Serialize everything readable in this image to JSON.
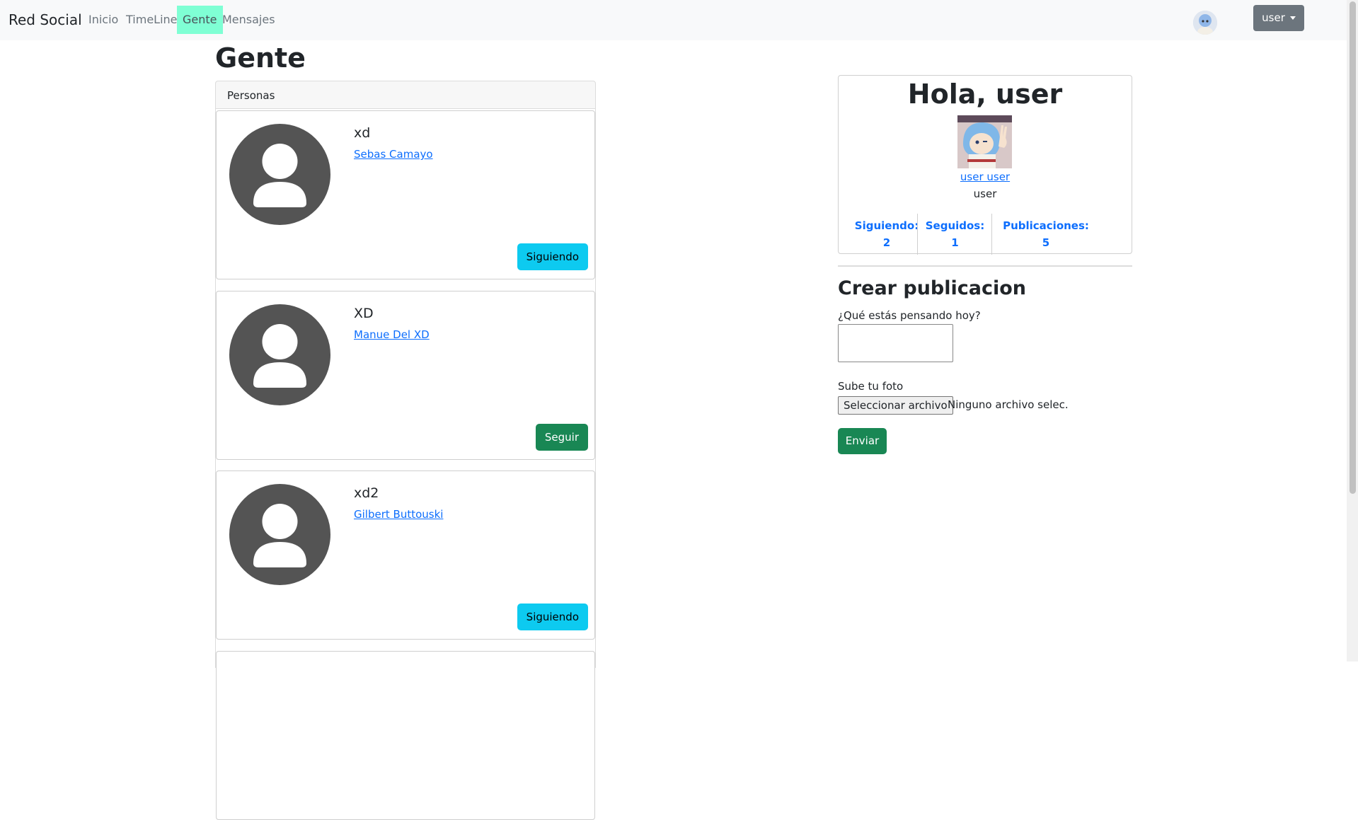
{
  "navbar": {
    "brand": "Red Social",
    "links": [
      "Inicio",
      "TimeLine",
      "Gente",
      "Mensajes"
    ],
    "active": "Gente",
    "user_button": "user"
  },
  "page": {
    "title": "Gente"
  },
  "people": {
    "header": "Personas",
    "list": [
      {
        "username": "xd",
        "full_name": "Sebas Camayo",
        "button": "Siguiendo"
      },
      {
        "username": "XD",
        "full_name": "Manue Del XD",
        "button": "Seguir"
      },
      {
        "username": "xd2",
        "full_name": "Gilbert Buttouski",
        "button": "Siguiendo"
      }
    ]
  },
  "profile": {
    "greeting": "Hola, user",
    "full_name": "user user",
    "username": "user",
    "stats": [
      {
        "label": "Siguiendo:",
        "value": "2"
      },
      {
        "label": "Seguidos:",
        "value": "1"
      },
      {
        "label": "Publicaciones:",
        "value": "5"
      }
    ]
  },
  "create_post": {
    "title": "Crear publicacion",
    "text_label": "¿Qué estás pensando hoy?",
    "photo_label": "Sube tu foto",
    "file_button": "Seleccionar archivo",
    "file_status": "Ninguno archivo selec.",
    "submit": "Enviar"
  },
  "colors": {
    "active_nav": "#7fffd4",
    "following_button": "#0dcaf0",
    "follow_button": "#198754",
    "link": "#0d6efd"
  },
  "icons": {
    "person_avatar": "person-silhouette-icon",
    "dropdown": "caret-down-icon"
  }
}
